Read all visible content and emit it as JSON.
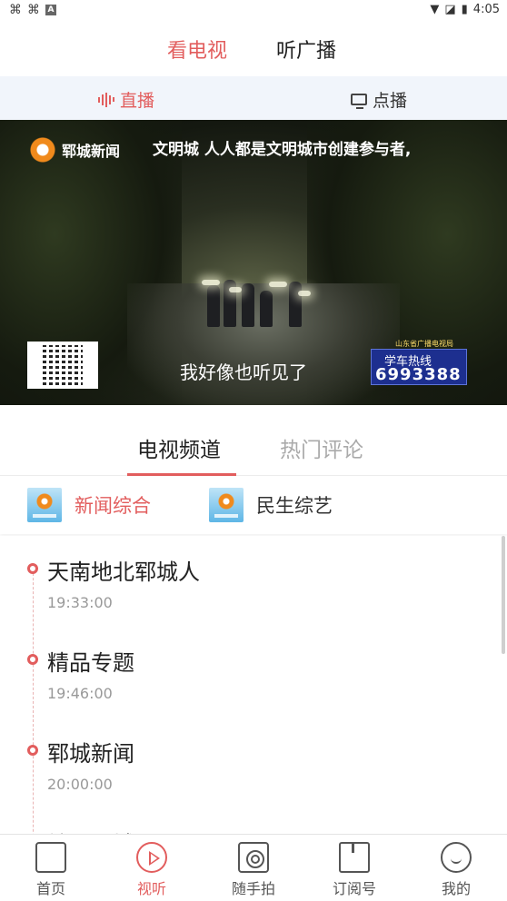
{
  "status_bar": {
    "left_icons": [
      "notification-icon",
      "notification-icon",
      "a-icon"
    ],
    "right_icons": [
      "wifi-icon",
      "signal-off-icon",
      "battery-icon"
    ],
    "time": "4:05"
  },
  "top_tabs": [
    {
      "label": "看电视",
      "active": true
    },
    {
      "label": "听广播",
      "active": false
    }
  ],
  "sub_tabs": [
    {
      "label": "直播",
      "icon": "live-bars-icon",
      "active": true
    },
    {
      "label": "点播",
      "icon": "tv-icon",
      "active": false
    }
  ],
  "video": {
    "station_logo_text": "郓城新闻",
    "ticker_text": "文明城  人人都是文明城市创建参与者,",
    "subtitle": "我好像也听见了",
    "hotline_caption": "山东省广播电视局",
    "hotline_label": "学车热线",
    "hotline_number": "6993388"
  },
  "channel_tabs": [
    {
      "label": "电视频道",
      "active": true
    },
    {
      "label": "热门评论",
      "active": false
    }
  ],
  "channels": [
    {
      "name": "新闻综合",
      "active": true
    },
    {
      "name": "民生综艺",
      "active": false
    }
  ],
  "schedule": [
    {
      "title": "天南地北郓城人",
      "time": "19:33:00"
    },
    {
      "title": "精品专题",
      "time": "19:46:00"
    },
    {
      "title": "郓城新闻",
      "time": "20:00:00"
    },
    {
      "title": "精彩郓城",
      "time": ""
    }
  ],
  "bottom_nav": [
    {
      "label": "首页",
      "icon": "home-icon",
      "active": false
    },
    {
      "label": "视听",
      "icon": "play-icon",
      "active": true
    },
    {
      "label": "随手拍",
      "icon": "camera-icon",
      "active": false
    },
    {
      "label": "订阅号",
      "icon": "bookmark-icon",
      "active": false
    },
    {
      "label": "我的",
      "icon": "profile-icon",
      "active": false
    }
  ],
  "colors": {
    "accent": "#e25d5d",
    "subtab_bg": "#f1f5fb"
  }
}
